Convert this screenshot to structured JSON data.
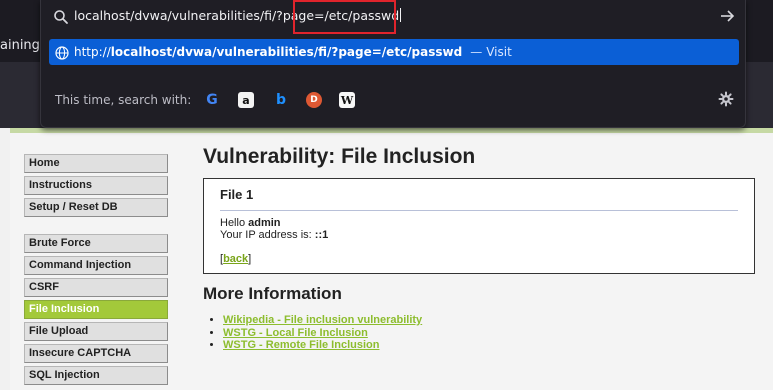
{
  "browser": {
    "tab_fragment": "aining"
  },
  "url_bar": {
    "value": "localhost/dvwa/vulnerabilities/fi/?page=/etc/passwd",
    "suggestion": {
      "prefix": "http://",
      "url": "localhost/dvwa/vulnerabilities/fi/?page=/etc/passwd",
      "separator": "—",
      "action": "Visit"
    },
    "search_with_label": "This time, search with:",
    "engines": [
      "google-icon",
      "amazon-icon",
      "bing-icon",
      "duckduckgo-icon",
      "wikipedia-icon"
    ],
    "engine_glyphs": {
      "google": "G",
      "amazon": "a",
      "bing": "b",
      "ddg": "D",
      "wiki": "W"
    }
  },
  "menu": {
    "group1": [
      "Home",
      "Instructions",
      "Setup / Reset DB"
    ],
    "group2": [
      "Brute Force",
      "Command Injection",
      "CSRF",
      "File Inclusion",
      "File Upload",
      "Insecure CAPTCHA",
      "SQL Injection"
    ],
    "selected": "File Inclusion"
  },
  "content": {
    "title": "Vulnerability: File Inclusion",
    "box_title": "File 1",
    "hello_prefix": "Hello ",
    "hello_user": "admin",
    "ip_prefix": "Your IP address is: ",
    "ip_value": "::1",
    "back_open": "[",
    "back_link": "back",
    "back_close": "]",
    "more_title": "More Information",
    "links": [
      "Wikipedia - File inclusion vulnerability",
      "WSTG - Local File Inclusion",
      "WSTG - Remote File Inclusion"
    ]
  },
  "colors": {
    "highlight": "#e0242c",
    "suggestion_bg": "#0b5fd6",
    "menu_selected": "#a3c93a",
    "link": "#8dbd2e"
  }
}
